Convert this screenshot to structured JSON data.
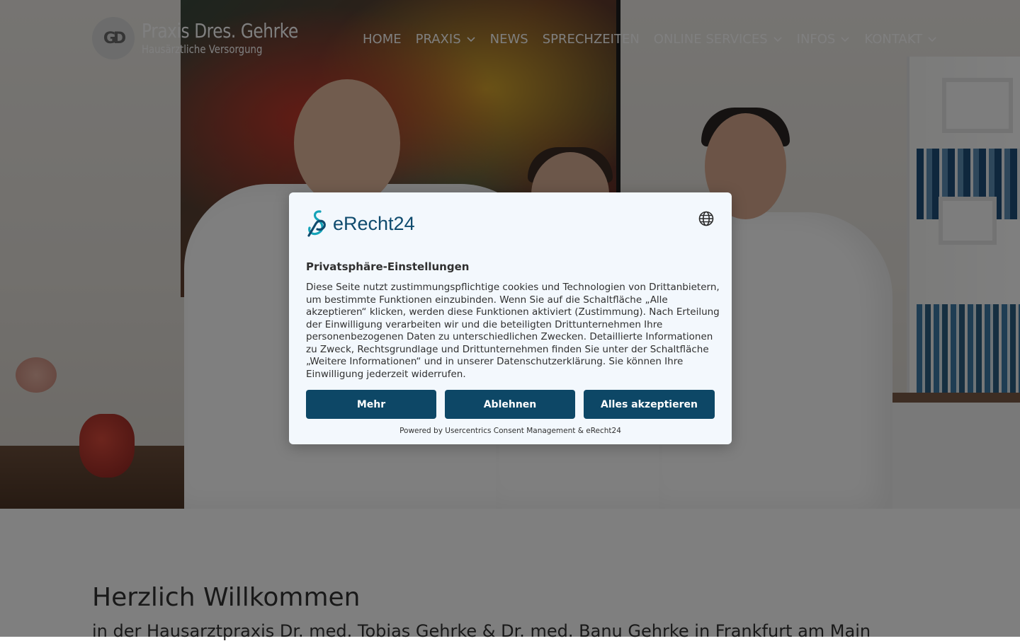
{
  "header": {
    "logo_mark_text": "GD",
    "logo_title": "Praxis Dres. Gehrke",
    "logo_subtitle": "Hausärztliche Versorgung"
  },
  "nav": {
    "items": [
      {
        "label": "HOME",
        "has_dropdown": false
      },
      {
        "label": "PRAXIS",
        "has_dropdown": true
      },
      {
        "label": "NEWS",
        "has_dropdown": false
      },
      {
        "label": "SPRECHZEITEN",
        "has_dropdown": false
      },
      {
        "label": "ONLINE SERVICES",
        "has_dropdown": true
      },
      {
        "label": "INFOS",
        "has_dropdown": true
      },
      {
        "label": "KONTAKT",
        "has_dropdown": true
      }
    ],
    "icon": "chevron-down-icon"
  },
  "main": {
    "title": "Herzlich Willkommen",
    "subtitle": "in der Hausarztpraxis Dr. med. Tobias Gehrke & Dr. med. Banu Gehrke in Frankfurt am Main"
  },
  "consent": {
    "brand": "eRecht24",
    "brand_icon": "erecht24-logo-icon",
    "language_icon": "globe-icon",
    "title": "Privatsphäre-Einstellungen",
    "body": "Diese Seite nutzt zustimmungspflichtige cookies und Technologien von Drittanbietern, um bestimmte Funktionen einzubinden. Wenn Sie auf die Schaltfläche „Alle akzeptieren“ klicken, werden diese Funktionen aktiviert (Zustimmung). Nach Erteilung der Einwilligung verarbeiten wir und die beteiligten Drittunternehmen Ihre personenbezogenen Daten zu unterschiedlichen Zwecken. Detaillierte Informationen zu Zweck, Rechtsgrundlage und Drittunternehmen finden Sie unter der Schaltfläche „Weitere Informationen“ und in unserer Datenschutzerklärung. Sie können Ihre Einwilligung jederzeit widerrufen.",
    "buttons": {
      "more": "Mehr",
      "deny": "Ablehnen",
      "accept": "Alles akzeptieren"
    },
    "powered_by": "Powered by Usercentrics Consent Management & eRecht24"
  },
  "colors": {
    "button_bg": "#0d4766",
    "dialog_bg": "#f3f8fd",
    "brand_text": "#0f4b6e",
    "overlay": "rgba(0,0,0,0.5)"
  }
}
